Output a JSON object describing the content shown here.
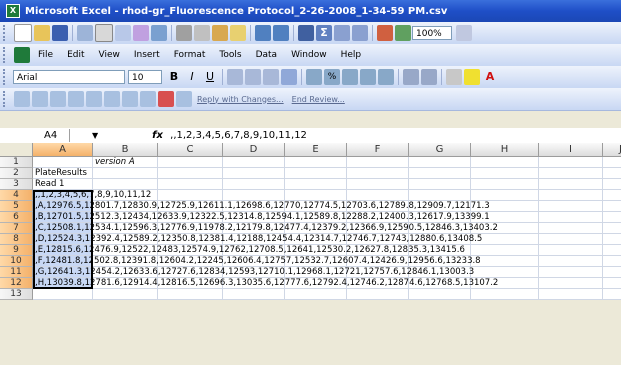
{
  "window": {
    "title": "Microsoft Excel - rhod-gr_Fluorescence Protocol_2-26-2008_1-34-59 PM.csv"
  },
  "menu": [
    "File",
    "Edit",
    "View",
    "Insert",
    "Format",
    "Tools",
    "Data",
    "Window",
    "Help"
  ],
  "toolbar": {
    "zoom": "100%",
    "font_name": "Arial",
    "font_size": "10",
    "reply_label": "Reply with Changes...",
    "end_review_label": "End Review..."
  },
  "formula_bar": {
    "name_box": "A4",
    "fx": "fx",
    "content": ",,1,2,3,4,5,6,7,8,9,10,11,12"
  },
  "columns": [
    "A",
    "B",
    "C",
    "D",
    "E",
    "F",
    "G",
    "H",
    "I",
    "J"
  ],
  "rows": [
    "1",
    "2",
    "3",
    "4",
    "5",
    "6",
    "7",
    "8",
    "9",
    "10",
    "11",
    "12",
    "13"
  ],
  "cells": [
    {
      "row": 1,
      "col": 2,
      "text": "version A",
      "italic": true
    },
    {
      "row": 2,
      "col": 1,
      "text": "PlateResults"
    },
    {
      "row": 3,
      "col": 1,
      "text": "Read 1"
    },
    {
      "row": 4,
      "col": 1,
      "text": ",,1,2,3,4,5,6,7,8,9,10,11,12"
    },
    {
      "row": 5,
      "col": 1,
      "text": ",A,12976.5,12801.7,12830.9,12725.9,12611.1,12698.6,12770,12774.5,12703.6,12789.8,12909.7,12171.3"
    },
    {
      "row": 6,
      "col": 1,
      "text": ",B,12701.5,12512.3,12434,12633.9,12322.5,12314.8,12594.1,12589.8,12288.2,12400.3,12617.9,13399.1"
    },
    {
      "row": 7,
      "col": 1,
      "text": ",C,12508.1,12534.1,12596.3,12776.9,11978.2,12179.8,12477.4,12379.2,12366.9,12590.5,12846.3,13403.2"
    },
    {
      "row": 8,
      "col": 1,
      "text": ",D,12524.3,12392.4,12589.2,12350.8,12381.4,12188,12454.4,12314.7,12746.7,12743,12880.6,13408.5"
    },
    {
      "row": 9,
      "col": 1,
      "text": ",E,12815.6,12476.9,12522,12483,12574.9,12762,12708.5,12641,12530.2,12627.8,12835.3,13415.6"
    },
    {
      "row": 10,
      "col": 1,
      "text": ",F,12481.8,12502.8,12391.8,12604.2,12245,12606.4,12757,12532.7,12607.4,12426.9,12956.6,13233.8"
    },
    {
      "row": 11,
      "col": 1,
      "text": ",G,12641.3,12454.2,12633.6,12727.6,12834,12593,12710.1,12968.1,12721,12757.6,12846.1,13003.3"
    },
    {
      "row": 12,
      "col": 1,
      "text": ",H,13039.8,12781.6,12914.4,12816.5,12696.3,13035.6,12777.6,12792.4,12746.2,12874.6,12768.5,13107.2"
    }
  ],
  "colors": {
    "title_blue": "#1f4fc7",
    "selection": "#c8d8f5",
    "header_selected": "#f4b16a"
  }
}
